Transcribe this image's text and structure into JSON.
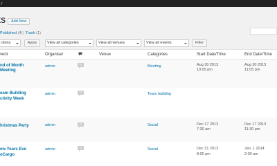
{
  "adminbar": {
    "mark": "y"
  },
  "header": {
    "title_fragment": "ts",
    "add_new": "Add New"
  },
  "views": {
    "published_label": "Published",
    "published_count": "(4)",
    "separator": "|",
    "trash_label": "Trash",
    "trash_count": "(1)"
  },
  "toolbar": {
    "bulk_actions": "ctions",
    "apply": "Apply",
    "categories_filter": "View all categories",
    "venues_filter": "View all venues",
    "events_filter": "View all events",
    "filter": "Filter"
  },
  "columns": {
    "event": "vent",
    "organiser": "Organiser",
    "venue": "Venue",
    "categories": "Categories",
    "start": "Start Date/Time",
    "end": "End Date/Time"
  },
  "events": [
    {
      "title_line1": "nd of Month",
      "title_line2": "Meeting",
      "organiser": "admin",
      "comments": "0",
      "category": "Meeting",
      "start_date": "Aug 30 2013",
      "start_time": "10:05 pm",
      "end_date": "Aug 30 2013",
      "end_time": "11:05 pm"
    },
    {
      "title_line1": "eam Building",
      "title_line2": "ctivity Week",
      "organiser": "admin",
      "comments": "0",
      "category": "Team building",
      "start_date": "",
      "start_time": "",
      "end_date": "",
      "end_time": ""
    },
    {
      "title_line1": "hristmas Party",
      "title_line2": "",
      "organiser": "admin",
      "comments": "0",
      "category": "Social",
      "start_date": "Dec 17 2013",
      "start_time": "7:30 am",
      "end_date": "Dec 17 2013",
      "end_time": "11:30 pm"
    },
    {
      "title_line1": "ew Years Eve",
      "title_line2": "oCargo",
      "organiser": "admin",
      "comments": "0",
      "category": "Social",
      "start_date": "Dec 31 2013",
      "start_time": "8:00 pm",
      "end_date": "Jan, 1 2014",
      "end_time": "2:00 am"
    }
  ],
  "colors": {
    "link": "#0073aa",
    "adminbar": "#222222",
    "bubble": "#cccccc"
  }
}
